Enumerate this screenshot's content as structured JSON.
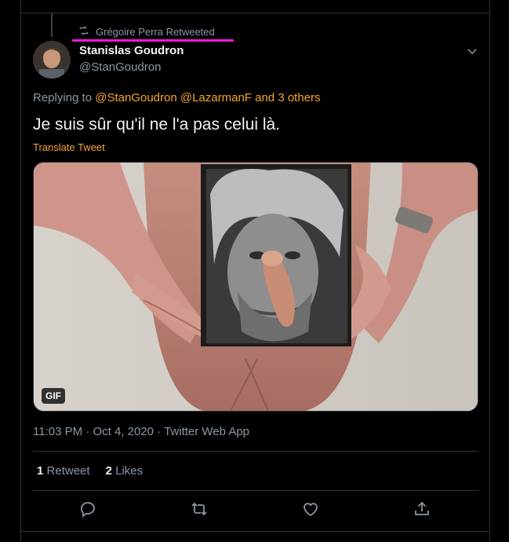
{
  "retweet_header": {
    "text": "Grégoire Perra Retweeted"
  },
  "author": {
    "name": "Stanislas Goudron",
    "handle": "@StanGoudron"
  },
  "replying": {
    "prefix": "Replying to",
    "mention1": "@StanGoudron",
    "mention2": "@LazarmanF",
    "connector": "and",
    "others": "3 others"
  },
  "tweet": {
    "text": "Je suis sûr qu'il ne l'a pas celui là.",
    "translate_label": "Translate Tweet"
  },
  "media": {
    "badge": "GIF"
  },
  "meta": {
    "time": "11:03 PM",
    "dot": "·",
    "date": "Oct 4, 2020",
    "dot2": "·",
    "source": "Twitter Web App"
  },
  "stats": {
    "retweets_count": "1",
    "retweets_label": "Retweet",
    "likes_count": "2",
    "likes_label": "Likes"
  },
  "icons": {
    "retweet_header": "retweet-icon",
    "caret": "chevron-down-icon",
    "reply": "reply-icon",
    "retweet": "retweet-icon",
    "like": "heart-icon",
    "share": "share-icon"
  },
  "colors": {
    "accent": "#f4a62a",
    "highlight": "#f01ad8",
    "background": "#000000",
    "muted": "#8b98a5"
  }
}
